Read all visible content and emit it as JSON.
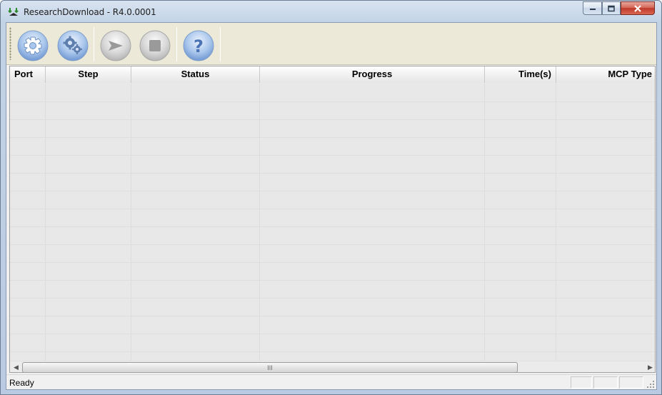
{
  "window": {
    "title": "ResearchDownload - R4.0.0001",
    "controls": [
      "minimize-icon",
      "maximize-icon",
      "close-icon"
    ]
  },
  "toolbar": {
    "buttons": [
      {
        "name": "load-packet-button",
        "icon": "gear-icon"
      },
      {
        "name": "settings-button",
        "icon": "gears-icon"
      },
      {
        "name": "start-download-button",
        "icon": "play-arrow-icon"
      },
      {
        "name": "stop-download-button",
        "icon": "stop-square-icon"
      },
      {
        "name": "help-button",
        "icon": "question-mark-icon"
      }
    ]
  },
  "listview": {
    "columns": [
      {
        "label": "Port",
        "align": "left"
      },
      {
        "label": "Step",
        "align": "center"
      },
      {
        "label": "Status",
        "align": "center"
      },
      {
        "label": "Progress",
        "align": "center"
      },
      {
        "label": "Time(s)",
        "align": "right"
      },
      {
        "label": "MCP Type",
        "align": "right"
      }
    ],
    "rows": []
  },
  "scrollbar": {
    "grip_glyph": "III"
  },
  "statusbar": {
    "text": "Ready"
  },
  "colors": {
    "toolbar_bg": "#ece9d8",
    "list_bg": "#e8e8e8",
    "button_blue": "#7ea6dc",
    "button_gray": "#d0d0d0"
  }
}
